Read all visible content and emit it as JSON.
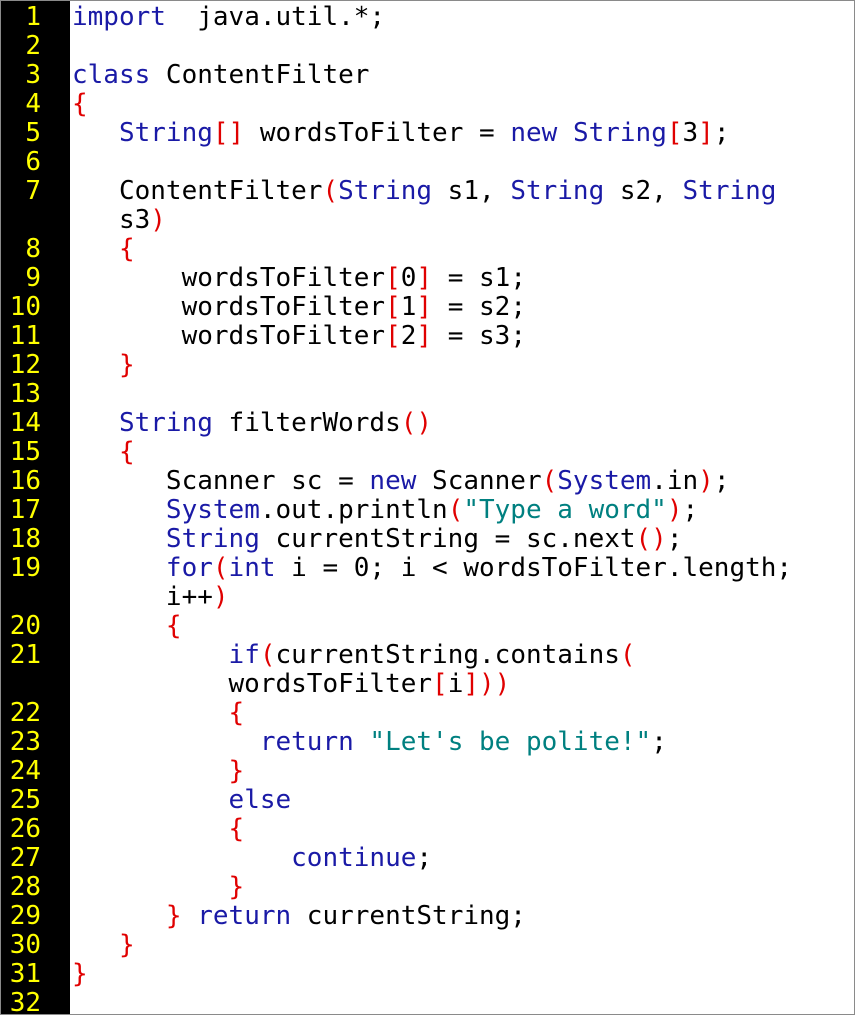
{
  "colors": {
    "background": "#ffffff",
    "gutter": "#000000",
    "line_number": "#ffff00",
    "keyword": "#1a1aa6",
    "bracket": "#e00000",
    "string": "#008080",
    "default": "#000000"
  },
  "lines": [
    {
      "n": "1",
      "segments": [
        [
          "kw",
          "import"
        ],
        [
          "",
          "  java.util.*;"
        ]
      ]
    },
    {
      "n": "2",
      "segments": []
    },
    {
      "n": "3",
      "segments": [
        [
          "kw",
          "class"
        ],
        [
          "",
          " ContentFilter"
        ]
      ]
    },
    {
      "n": "4",
      "segments": [
        [
          "op",
          "{"
        ]
      ]
    },
    {
      "n": "5",
      "segments": [
        [
          "",
          "   "
        ],
        [
          "kw",
          "String"
        ],
        [
          "op",
          "[]"
        ],
        [
          "",
          " wordsToFilter = "
        ],
        [
          "kw",
          "new"
        ],
        [
          "",
          " "
        ],
        [
          "kw",
          "String"
        ],
        [
          "op",
          "["
        ],
        [
          "",
          "3"
        ],
        [
          "op",
          "]"
        ],
        [
          "",
          ";"
        ]
      ]
    },
    {
      "n": "6",
      "segments": []
    },
    {
      "n": "7",
      "segments": [
        [
          "",
          "   ContentFilter"
        ],
        [
          "op",
          "("
        ],
        [
          "kw",
          "String"
        ],
        [
          "",
          " s1, "
        ],
        [
          "kw",
          "String"
        ],
        [
          "",
          " s2, "
        ],
        [
          "kw",
          "String"
        ]
      ]
    },
    {
      "n": "",
      "segments": [
        [
          "",
          "   s3"
        ],
        [
          "op",
          ")"
        ]
      ]
    },
    {
      "n": "8",
      "segments": [
        [
          "",
          "   "
        ],
        [
          "op",
          "{"
        ]
      ]
    },
    {
      "n": "9",
      "segments": [
        [
          "",
          "       wordsToFilter"
        ],
        [
          "op",
          "["
        ],
        [
          "",
          "0"
        ],
        [
          "op",
          "]"
        ],
        [
          "",
          " = s1;"
        ]
      ]
    },
    {
      "n": "10",
      "segments": [
        [
          "",
          "       wordsToFilter"
        ],
        [
          "op",
          "["
        ],
        [
          "",
          "1"
        ],
        [
          "op",
          "]"
        ],
        [
          "",
          " = s2;"
        ]
      ]
    },
    {
      "n": "11",
      "segments": [
        [
          "",
          "       wordsToFilter"
        ],
        [
          "op",
          "["
        ],
        [
          "",
          "2"
        ],
        [
          "op",
          "]"
        ],
        [
          "",
          " = s3;"
        ]
      ]
    },
    {
      "n": "12",
      "segments": [
        [
          "",
          "   "
        ],
        [
          "op",
          "}"
        ]
      ]
    },
    {
      "n": "13",
      "segments": []
    },
    {
      "n": "14",
      "segments": [
        [
          "",
          "   "
        ],
        [
          "kw",
          "String"
        ],
        [
          "",
          " filterWords"
        ],
        [
          "op",
          "()"
        ]
      ]
    },
    {
      "n": "15",
      "segments": [
        [
          "",
          "   "
        ],
        [
          "op",
          "{"
        ]
      ]
    },
    {
      "n": "16",
      "segments": [
        [
          "",
          "      Scanner sc = "
        ],
        [
          "kw",
          "new"
        ],
        [
          "",
          " Scanner"
        ],
        [
          "op",
          "("
        ],
        [
          "kw",
          "System"
        ],
        [
          "",
          ".in"
        ],
        [
          "op",
          ")"
        ],
        [
          "",
          ";"
        ]
      ]
    },
    {
      "n": "17",
      "segments": [
        [
          "",
          "      "
        ],
        [
          "kw",
          "System"
        ],
        [
          "",
          ".out.println"
        ],
        [
          "op",
          "("
        ],
        [
          "str",
          "\"Type a word\""
        ],
        [
          "op",
          ")"
        ],
        [
          "",
          ";"
        ]
      ]
    },
    {
      "n": "18",
      "segments": [
        [
          "",
          "      "
        ],
        [
          "kw",
          "String"
        ],
        [
          "",
          " currentString = sc.next"
        ],
        [
          "op",
          "()"
        ],
        [
          "",
          ";"
        ]
      ]
    },
    {
      "n": "19",
      "segments": [
        [
          "",
          "      "
        ],
        [
          "kw",
          "for"
        ],
        [
          "op",
          "("
        ],
        [
          "kw",
          "int"
        ],
        [
          "",
          " i = 0; i < wordsToFilter.length;"
        ]
      ]
    },
    {
      "n": "",
      "segments": [
        [
          "",
          "      i++"
        ],
        [
          "op",
          ")"
        ]
      ]
    },
    {
      "n": "20",
      "segments": [
        [
          "",
          "      "
        ],
        [
          "op",
          "{"
        ]
      ]
    },
    {
      "n": "21",
      "segments": [
        [
          "",
          "          "
        ],
        [
          "kw",
          "if"
        ],
        [
          "op",
          "("
        ],
        [
          "",
          "currentString.contains"
        ],
        [
          "op",
          "("
        ]
      ]
    },
    {
      "n": "",
      "segments": [
        [
          "",
          "          wordsToFilter"
        ],
        [
          "op",
          "["
        ],
        [
          "",
          "i"
        ],
        [
          "op",
          "]))"
        ]
      ]
    },
    {
      "n": "22",
      "segments": [
        [
          "",
          "          "
        ],
        [
          "op",
          "{"
        ]
      ]
    },
    {
      "n": "23",
      "segments": [
        [
          "",
          "            "
        ],
        [
          "kw",
          "return"
        ],
        [
          "",
          " "
        ],
        [
          "str",
          "\"Let's be polite!\""
        ],
        [
          "",
          ";"
        ]
      ]
    },
    {
      "n": "24",
      "segments": [
        [
          "",
          "          "
        ],
        [
          "op",
          "}"
        ]
      ]
    },
    {
      "n": "25",
      "segments": [
        [
          "",
          "          "
        ],
        [
          "kw",
          "else"
        ]
      ]
    },
    {
      "n": "26",
      "segments": [
        [
          "",
          "          "
        ],
        [
          "op",
          "{"
        ]
      ]
    },
    {
      "n": "27",
      "segments": [
        [
          "",
          "              "
        ],
        [
          "kw",
          "continue"
        ],
        [
          "",
          ";"
        ]
      ]
    },
    {
      "n": "28",
      "segments": [
        [
          "",
          "          "
        ],
        [
          "op",
          "}"
        ]
      ]
    },
    {
      "n": "29",
      "segments": [
        [
          "",
          "      "
        ],
        [
          "op",
          "}"
        ],
        [
          "",
          " "
        ],
        [
          "kw",
          "return"
        ],
        [
          "",
          " currentString;"
        ]
      ]
    },
    {
      "n": "30",
      "segments": [
        [
          "",
          "   "
        ],
        [
          "op",
          "}"
        ]
      ]
    },
    {
      "n": "31",
      "segments": [
        [
          "op",
          "}"
        ]
      ]
    },
    {
      "n": "32",
      "segments": []
    }
  ]
}
